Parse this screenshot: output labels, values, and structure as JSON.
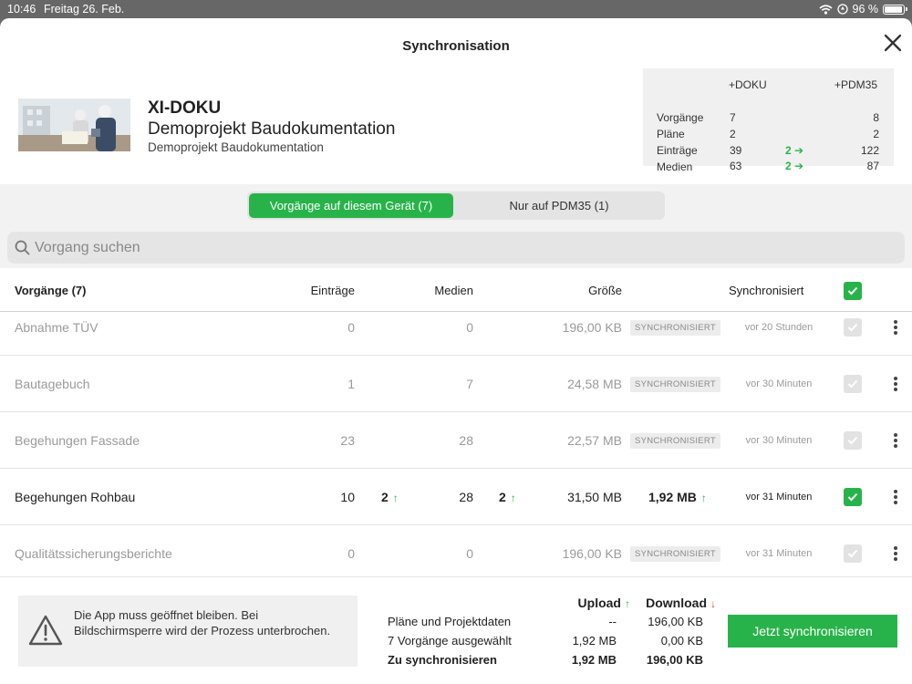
{
  "status_bar": {
    "time": "10:46",
    "date": "Freitag 26. Feb.",
    "battery": "96 %"
  },
  "dialog": {
    "title": "Synchronisation"
  },
  "project": {
    "name": "XI-DOKU",
    "title": "Demoprojekt Baudokumentation",
    "subtitle": "Demoprojekt Baudokumentation"
  },
  "stats": {
    "col_left": "DOKU",
    "col_right": "PDM35",
    "rows": [
      {
        "label": "Vorgänge",
        "left": "7",
        "delta": "",
        "right": "8"
      },
      {
        "label": "Pläne",
        "left": "2",
        "delta": "",
        "right": "2"
      },
      {
        "label": "Einträge",
        "left": "39",
        "delta": "2",
        "right": "122"
      },
      {
        "label": "Medien",
        "left": "63",
        "delta": "2",
        "right": "87"
      }
    ]
  },
  "segments": {
    "active": "Vorgänge auf diesem Gerät (7)",
    "inactive": "Nur auf PDM35 (1)"
  },
  "search": {
    "placeholder": "Vorgang suchen",
    "value": ""
  },
  "table": {
    "headers": {
      "name": "Vorgänge (7)",
      "entries": "Einträge",
      "media": "Medien",
      "size": "Größe",
      "synced": "Synchronisiert"
    },
    "rows": [
      {
        "name": "Abnahme TÜV",
        "entries": "0",
        "entries_delta": "",
        "media": "0",
        "media_delta": "",
        "size": "196,00 KB",
        "status": "SYNCHRONISIERT",
        "time": "vor 20 Stunden",
        "checked": false
      },
      {
        "name": "Bautagebuch",
        "entries": "1",
        "entries_delta": "",
        "media": "7",
        "media_delta": "",
        "size": "24,58 MB",
        "status": "SYNCHRONISIERT",
        "time": "vor 30 Minuten",
        "checked": false
      },
      {
        "name": "Begehungen Fassade",
        "entries": "23",
        "entries_delta": "",
        "media": "28",
        "media_delta": "",
        "size": "22,57 MB",
        "status": "SYNCHRONISIERT",
        "time": "vor 30 Minuten",
        "checked": false
      },
      {
        "name": "Begehungen Rohbau",
        "entries": "10",
        "entries_delta": "2",
        "media": "28",
        "media_delta": "2",
        "size": "31,50 MB",
        "status": "1,92 MB",
        "time": "vor 31 Minuten",
        "checked": true
      },
      {
        "name": "Qualitätssicherungsberichte",
        "entries": "0",
        "entries_delta": "",
        "media": "0",
        "media_delta": "",
        "size": "196,00 KB",
        "status": "SYNCHRONISIERT",
        "time": "vor 31 Minuten",
        "checked": false
      }
    ]
  },
  "footer": {
    "notice": "Die App muss geöffnet bleiben. Bei Bildschirmsperre wird der Prozess unterbrochen.",
    "upload_label": "Upload",
    "download_label": "Download",
    "lines": [
      {
        "label": "Pläne und Projektdaten",
        "upload": "--",
        "download": "196,00 KB"
      },
      {
        "label": "7 Vorgänge ausgewählt",
        "upload": "1,92 MB",
        "download": "0,00 KB"
      },
      {
        "label": "Zu synchronisieren",
        "upload": "1,92 MB",
        "download": "196,00 KB"
      }
    ],
    "sync_button": "Jetzt synchronisieren"
  },
  "colors": {
    "accent": "#28b34a",
    "arrow_down": "#e04a3a"
  }
}
